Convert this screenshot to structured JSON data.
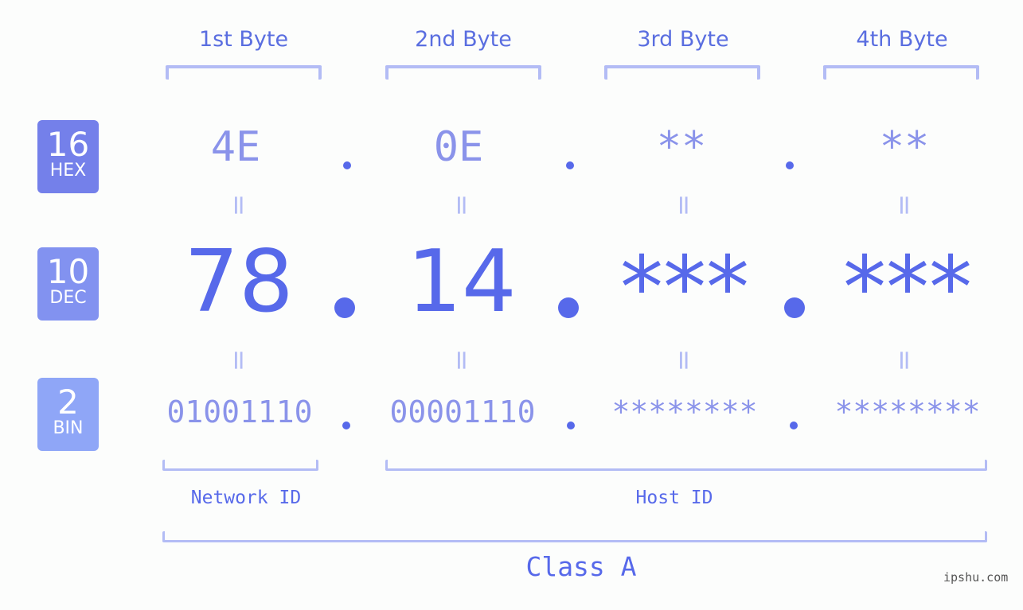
{
  "byte_headers": [
    "1st Byte",
    "2nd Byte",
    "3rd Byte",
    "4th Byte"
  ],
  "badges": [
    {
      "number": "16",
      "label": "HEX",
      "color": "#7480ea"
    },
    {
      "number": "10",
      "label": "DEC",
      "color": "#8292f0"
    },
    {
      "number": "2",
      "label": "BIN",
      "color": "#8fa6f7"
    }
  ],
  "hex": [
    "4E",
    "0E",
    "**",
    "**"
  ],
  "dec": [
    "78",
    "14",
    "***",
    "***"
  ],
  "bin": [
    "01001110",
    "00001110",
    "********",
    "********"
  ],
  "equals": "=",
  "network_id_label": "Network ID",
  "host_id_label": "Host ID",
  "class_label": "Class A",
  "watermark": "ipshu.com"
}
